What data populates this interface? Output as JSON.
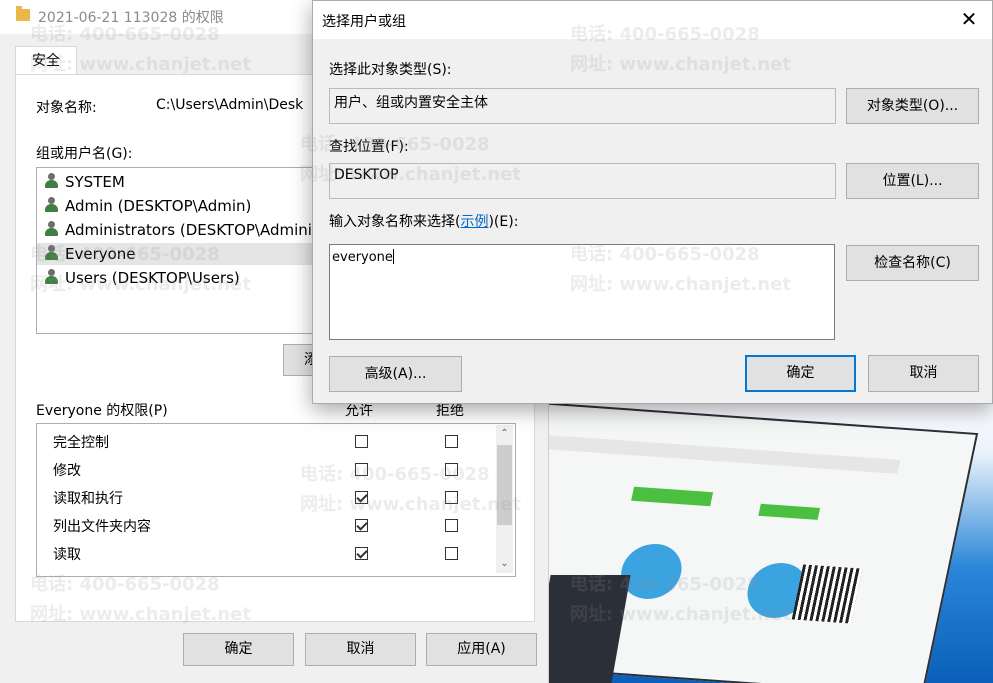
{
  "props_dialog": {
    "title": "2021-06-21 113028 的权限",
    "tab_security": "安全",
    "object_name_label": "对象名称:",
    "object_name_value": "C:\\Users\\Admin\\Desk",
    "group_label": "组或用户名(G):",
    "groups": [
      {
        "name": "SYSTEM",
        "icon": "group-icon"
      },
      {
        "name": "Admin (DESKTOP\\Admin)",
        "icon": "user-icon"
      },
      {
        "name": "Administrators (DESKTOP\\Adminis",
        "icon": "group-icon"
      },
      {
        "name": "Everyone",
        "icon": "group-icon",
        "selected": true
      },
      {
        "name": "Users (DESKTOP\\Users)",
        "icon": "group-icon"
      }
    ],
    "edit_button_partial": "添",
    "permissions_label": "Everyone 的权限(P)",
    "allow_header": "允许",
    "deny_header": "拒绝",
    "permissions": [
      {
        "name": "完全控制",
        "allow": false,
        "deny": false
      },
      {
        "name": "修改",
        "allow": false,
        "deny": false
      },
      {
        "name": "读取和执行",
        "allow": true,
        "deny": false
      },
      {
        "name": "列出文件夹内容",
        "allow": true,
        "deny": false
      },
      {
        "name": "读取",
        "allow": true,
        "deny": false
      }
    ],
    "ok_label": "确定",
    "cancel_label": "取消",
    "apply_label": "应用(A)"
  },
  "select_dialog": {
    "title": "选择用户或组",
    "close_glyph": "✕",
    "object_type_label": "选择此对象类型(S):",
    "object_type_value": "用户、组或内置安全主体",
    "object_types_button": "对象类型(O)...",
    "location_label": "查找位置(F):",
    "location_value": "DESKTOP",
    "location_button": "位置(L)...",
    "enter_label_prefix": "输入对象名称来选择(",
    "enter_label_link": "示例",
    "enter_label_suffix": ")(E):",
    "enter_value": "everyone",
    "check_names_button": "检查名称(C)",
    "advanced_button": "高级(A)...",
    "ok_button": "确定",
    "cancel_button": "取消"
  },
  "watermark": {
    "phone": "电话: 400-665-0028",
    "site": "网址: www.chanjet.net"
  },
  "colors": {
    "accent": "#0078d7",
    "link": "#0066cc",
    "selection": "#e5e5e5"
  }
}
